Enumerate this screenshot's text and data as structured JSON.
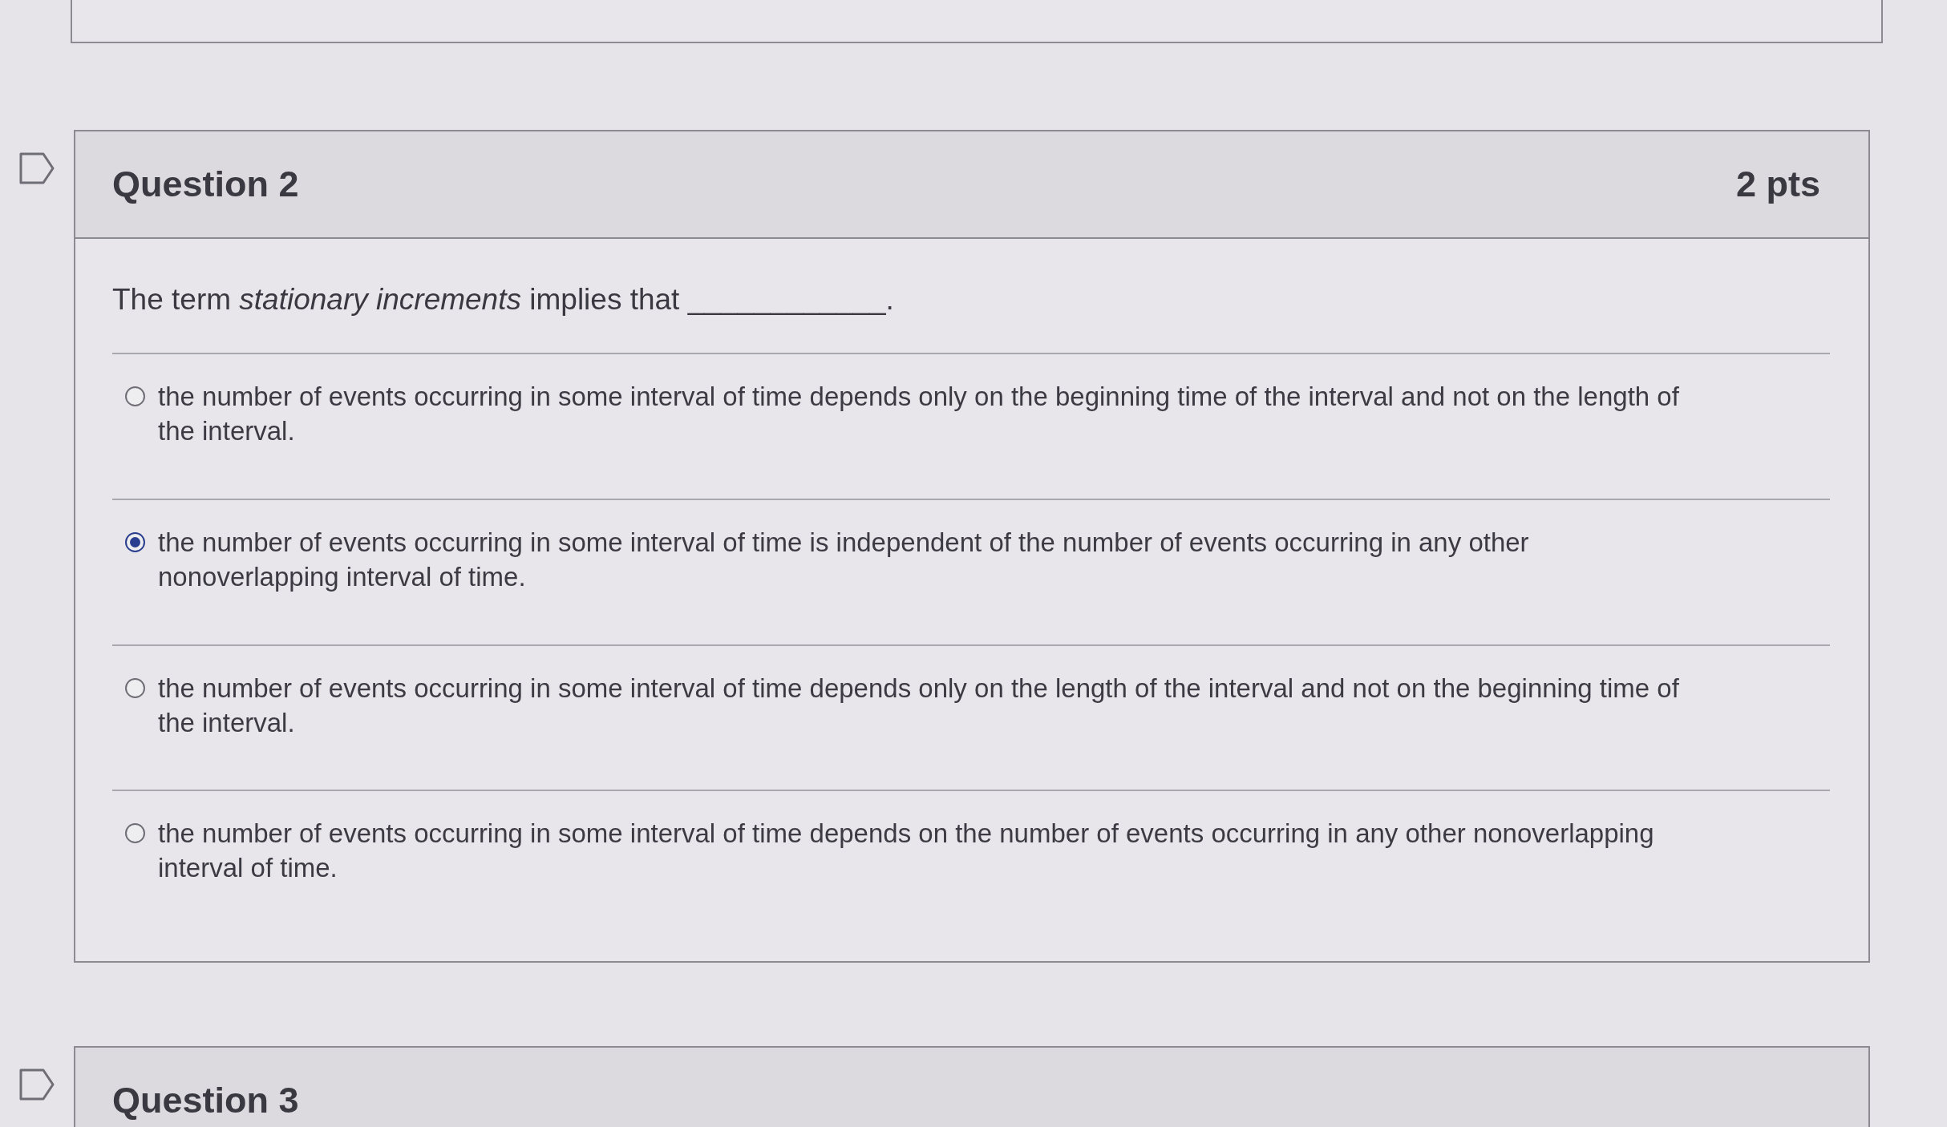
{
  "questions": [
    {
      "title": "Question 2",
      "points": "2 pts",
      "prompt": "The term *stationary increments* implies that ____________.",
      "answers": [
        {
          "text": "the number of events occurring in some interval of time depends only on the beginning time of the interval and not on the length of the interval.",
          "selected": false
        },
        {
          "text": "the number of events occurring in some interval of time is independent of the number of events occurring in any other nonoverlapping interval of time.",
          "selected": true
        },
        {
          "text": "the number of events occurring in some interval of time depends only on the length of the interval and not on the beginning time of the interval.",
          "selected": false
        },
        {
          "text": "the number of events occurring in some interval of time depends on the number of events occurring in any other nonoverlapping interval of time.",
          "selected": false
        }
      ]
    },
    {
      "title": "Question 3"
    }
  ]
}
